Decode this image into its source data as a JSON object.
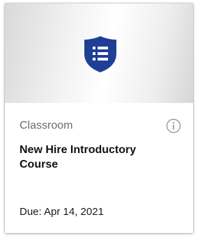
{
  "card": {
    "category": "Classroom",
    "title": "New Hire Introductory Course",
    "due": "Due: Apr 14, 2021",
    "icon": "shield-list-icon",
    "info_icon": "info-icon"
  },
  "colors": {
    "shield": "#1f3f96",
    "info_icon": "#9a9a9a"
  }
}
